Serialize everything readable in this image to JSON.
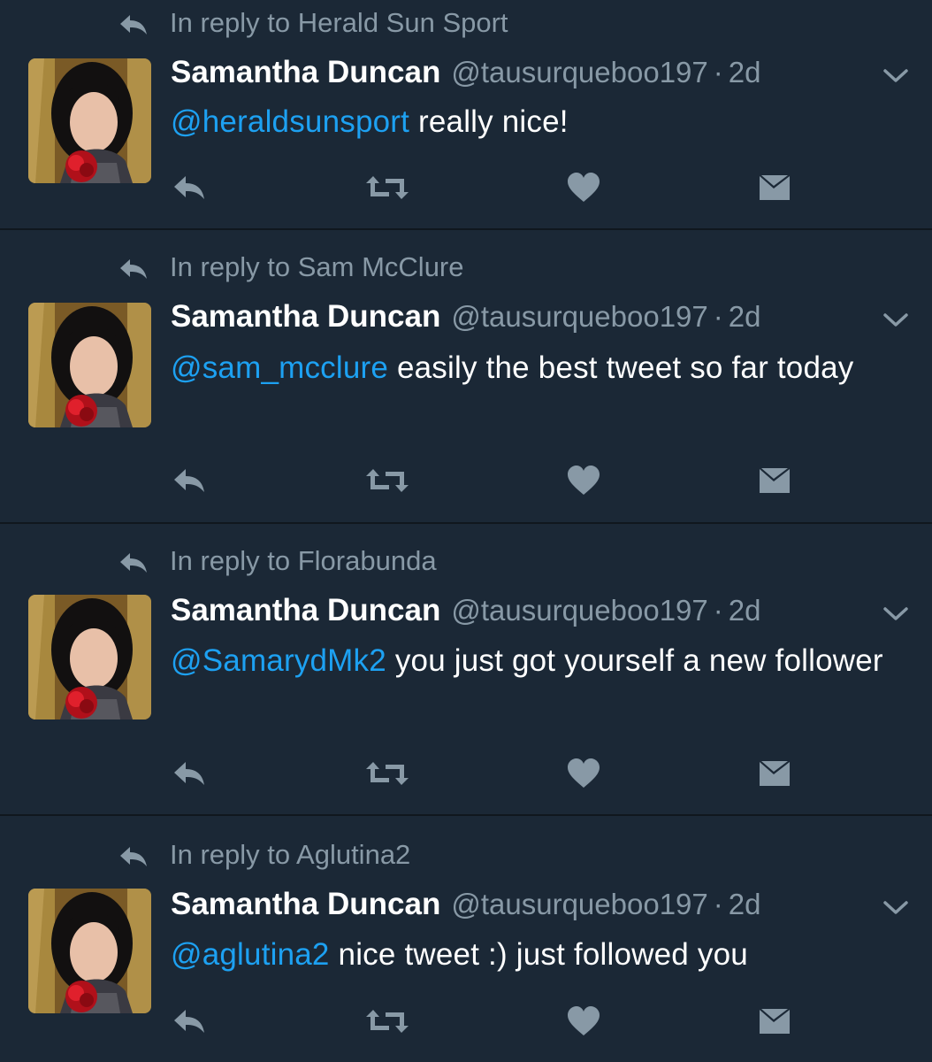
{
  "colors": {
    "background": "#1b2836",
    "divider": "#10171e",
    "muted": "#8899a6",
    "mention": "#1da1f2",
    "text": "#ffffff"
  },
  "icons": {
    "context": "reply-arrow-icon",
    "menu": "chevron-down-icon",
    "reply": "reply-icon",
    "retweet": "retweet-icon",
    "like": "heart-icon",
    "message": "direct-message-icon"
  },
  "tweets": [
    {
      "reply_to": "In reply to Herald Sun Sport",
      "name": "Samantha Duncan",
      "handle": "@tausurqueboo197",
      "separator": "·",
      "time": "2d",
      "mention": "@heraldsunsport",
      "text": " really nice!"
    },
    {
      "reply_to": "In reply to Sam McClure",
      "name": "Samantha Duncan",
      "handle": "@tausurqueboo197",
      "separator": "·",
      "time": "2d",
      "mention": "@sam_mcclure",
      "text": " easily the best tweet so far today"
    },
    {
      "reply_to": "In reply to Florabunda",
      "name": "Samantha Duncan",
      "handle": "@tausurqueboo197",
      "separator": "·",
      "time": "2d",
      "mention": "@SamarydMk2",
      "text": " you just got yourself a new follower"
    },
    {
      "reply_to": "In reply to Aglutina2",
      "name": "Samantha Duncan",
      "handle": "@tausurqueboo197",
      "separator": "·",
      "time": "2d",
      "mention": "@aglutina2",
      "text": " nice tweet :) just followed you"
    }
  ]
}
